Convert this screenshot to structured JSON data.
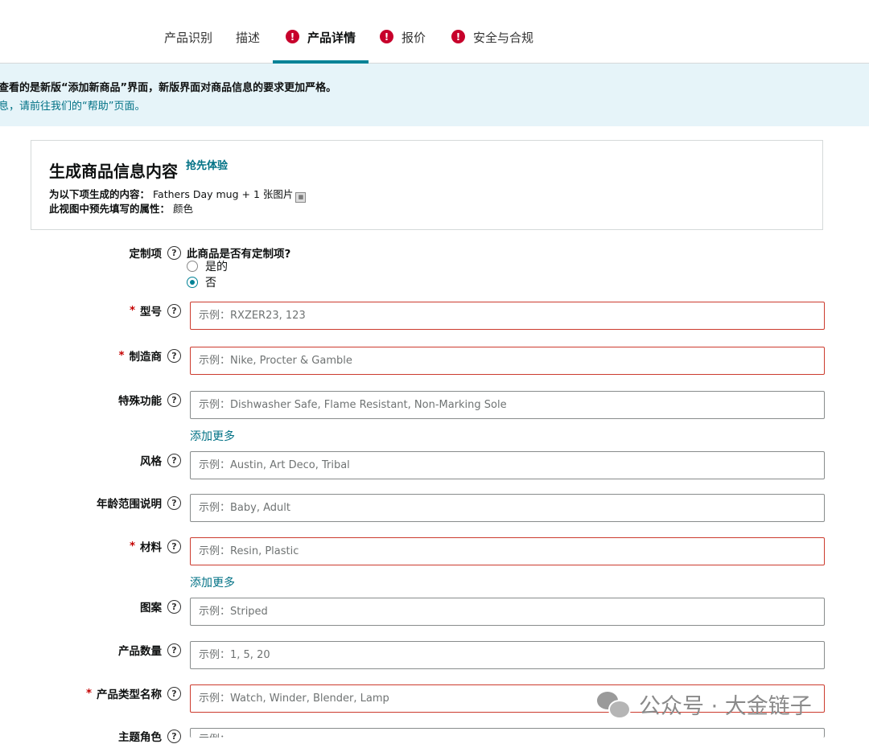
{
  "tabs": [
    {
      "label": "产品识别",
      "alert": false,
      "active": false
    },
    {
      "label": "描述",
      "alert": false,
      "active": false
    },
    {
      "label": "产品详情",
      "alert": true,
      "active": true
    },
    {
      "label": "报价",
      "alert": true,
      "active": false
    },
    {
      "label": "安全与合规",
      "alert": true,
      "active": false
    }
  ],
  "banner": {
    "line1": "查看的是新版“添加新商品”界面，新版界面对商品信息的要求更加严格。",
    "line2": "息，请前往我们的“帮助”页面。"
  },
  "ai_box": {
    "title": "生成商品信息内容",
    "badge": "抢先体验",
    "source_label": "为以下项生成的内容：",
    "source_value": "Fathers Day mug + 1 张图片",
    "prefill_label": "此视图中预先填写的属性：",
    "prefill_value": "颜色"
  },
  "customization": {
    "label": "定制项",
    "question": "此商品是否有定制项?",
    "options": [
      "是的",
      "否"
    ],
    "selected": "否"
  },
  "fields": {
    "model": {
      "label": "型号",
      "required": true,
      "placeholder": "示例：RXZER23, 123"
    },
    "manufacturer": {
      "label": "制造商",
      "required": true,
      "placeholder": "示例：Nike, Procter & Gamble"
    },
    "special_features": {
      "label": "特殊功能",
      "required": false,
      "placeholder": "示例：Dishwasher Safe, Flame Resistant, Non-Marking Sole"
    },
    "style": {
      "label": "风格",
      "required": false,
      "placeholder": "示例：Austin, Art Deco, Tribal"
    },
    "age_range": {
      "label": "年龄范围说明",
      "required": false,
      "placeholder": "示例：Baby, Adult"
    },
    "material": {
      "label": "材料",
      "required": true,
      "placeholder": "示例：Resin, Plastic"
    },
    "pattern": {
      "label": "图案",
      "required": false,
      "placeholder": "示例：Striped"
    },
    "quantity": {
      "label": "产品数量",
      "required": false,
      "placeholder": "示例：1, 5, 20"
    },
    "product_type": {
      "label": "产品类型名称",
      "required": true,
      "placeholder": "示例：Watch, Winder, Blender, Lamp"
    },
    "theme_character": {
      "label": "主题角色",
      "required": false,
      "placeholder": "示例："
    }
  },
  "add_more_label": "添加更多",
  "help_symbol": "?",
  "required_symbol": "*",
  "alert_symbol": "!",
  "watermark": {
    "text": "公众号 · 大金链子"
  },
  "colors": {
    "accent": "#008296",
    "link": "#007185",
    "alert": "#c7002b",
    "required_border": "#cc3b2e",
    "banner_bg": "#e6f4f9"
  }
}
